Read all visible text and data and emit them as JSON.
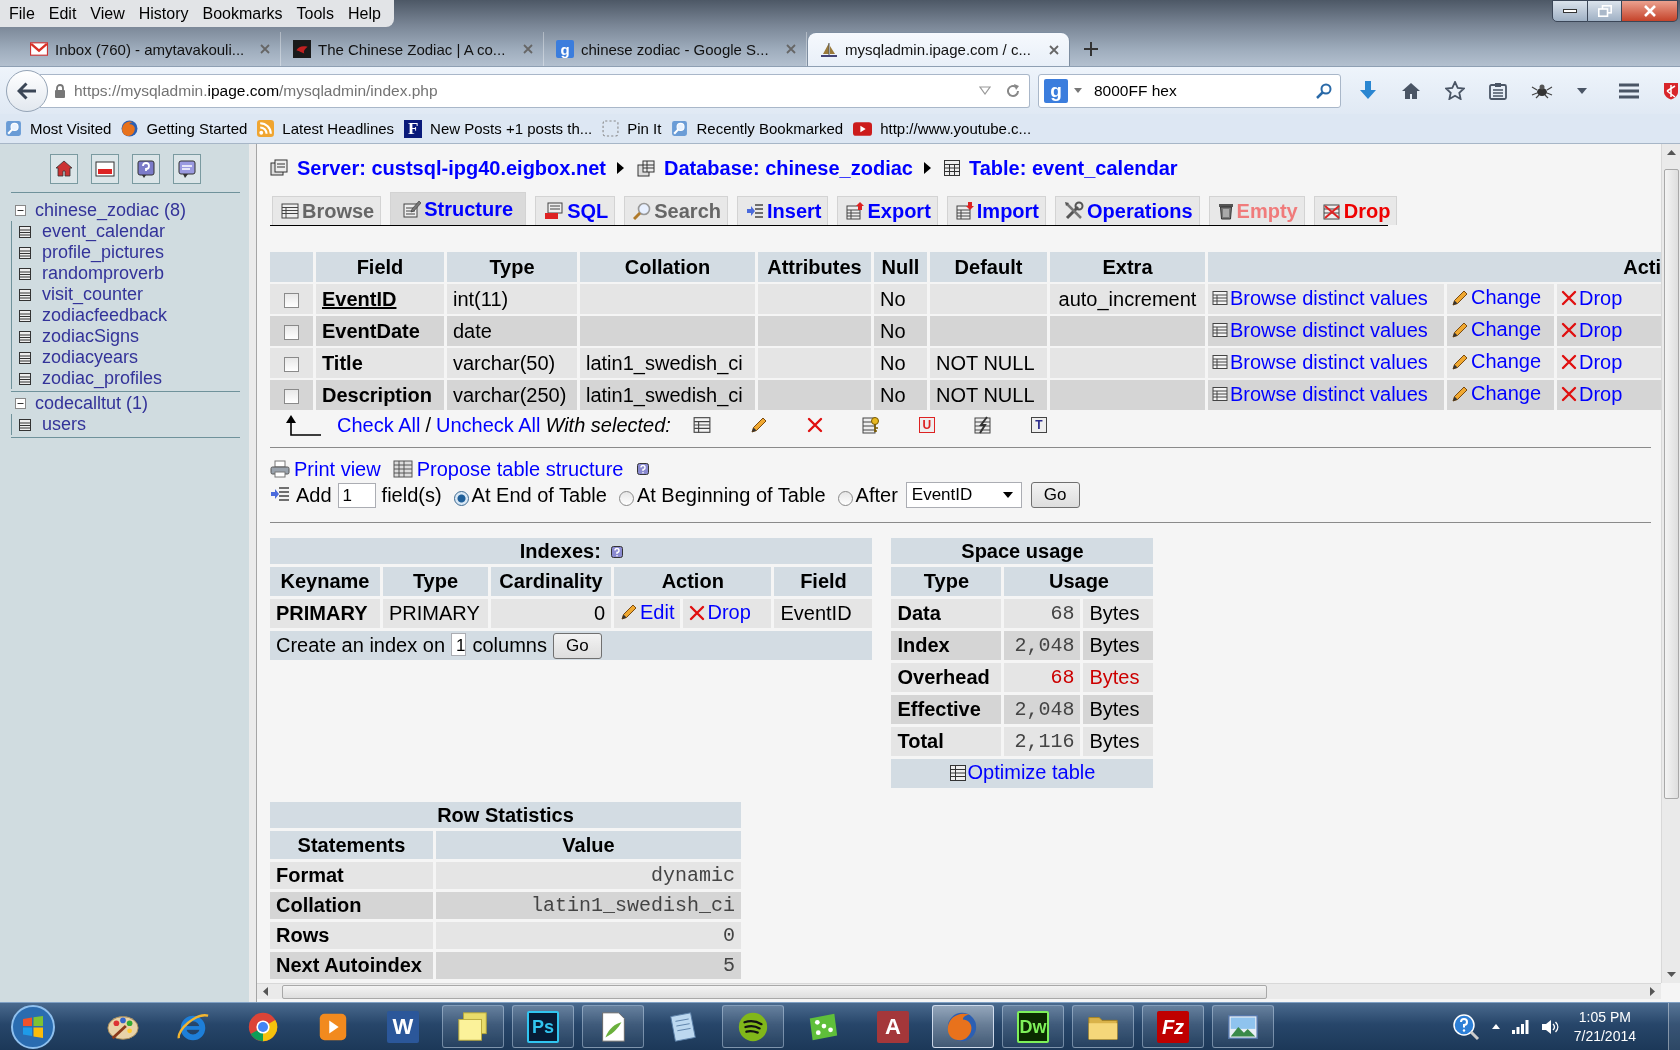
{
  "menu_bar": [
    "File",
    "Edit",
    "View",
    "History",
    "Bookmarks",
    "Tools",
    "Help"
  ],
  "browser_tabs": [
    {
      "kind": "mail",
      "title": "Inbox (760) - amytavakouli...",
      "selected": false
    },
    {
      "kind": "photo",
      "title": "The Chinese Zodiac | A co...",
      "selected": false
    },
    {
      "kind": "search",
      "glyph": "g",
      "title": "chinese zodiac - Google S...",
      "selected": false
    },
    {
      "kind": "pma",
      "title": "mysqladmin.ipage.com / c...",
      "selected": true
    }
  ],
  "address_bar": {
    "prefix": "https://mysqladmin.",
    "domain": "ipage.com",
    "path": "/mysqladmin/index.php"
  },
  "search_bar": {
    "glyph": "g",
    "value": "8000FF hex"
  },
  "bookmarks": [
    {
      "kind": "folder",
      "label": "Most Visited"
    },
    {
      "kind": "firefox",
      "label": "Getting Started"
    },
    {
      "kind": "feed",
      "label": "Latest Headlines"
    },
    {
      "kind": "letter",
      "glyph": "F",
      "label": "New Posts +1 posts th..."
    },
    {
      "kind": "dashed",
      "label": "Pin It"
    },
    {
      "kind": "folder",
      "label": "Recently Bookmarked"
    },
    {
      "kind": "video",
      "label": "http://www.youtube.c..."
    }
  ],
  "sidebar": {
    "databases": [
      {
        "name": "chinese_zodiac (8)",
        "expanded": true,
        "children": [
          {
            "name": "event_calendar"
          },
          {
            "name": "profile_pictures"
          },
          {
            "name": "randomproverb"
          },
          {
            "name": "visit_counter"
          },
          {
            "name": "zodiacfeedback"
          },
          {
            "name": "zodiacSigns"
          },
          {
            "name": "zodiacyears"
          },
          {
            "name": "zodiac_profiles"
          }
        ]
      },
      {
        "name": "codecalltut (1)",
        "expanded": true,
        "children": [
          {
            "name": "users"
          }
        ]
      }
    ]
  },
  "breadcrumb": [
    {
      "kind": "server",
      "label": "Server: custsql-ipg40.eigbox.net"
    },
    {
      "kind": "database",
      "label": "Database: chinese_zodiac"
    },
    {
      "kind": "table",
      "label": "Table: event_calendar"
    }
  ],
  "tabs": [
    {
      "kind": "browse",
      "label": "Browse",
      "selected": false,
      "disabled": true,
      "caution": false
    },
    {
      "kind": "structure",
      "label": "Structure",
      "selected": true,
      "disabled": false,
      "caution": false
    },
    {
      "kind": "sql",
      "label": "SQL",
      "selected": false,
      "disabled": false,
      "caution": false
    },
    {
      "kind": "search",
      "label": "Search",
      "selected": false,
      "disabled": true,
      "caution": false
    },
    {
      "kind": "insert",
      "label": "Insert",
      "selected": false,
      "disabled": false,
      "caution": false
    },
    {
      "kind": "export",
      "label": "Export",
      "selected": false,
      "disabled": false,
      "caution": false
    },
    {
      "kind": "import",
      "label": "Import",
      "selected": false,
      "disabled": false,
      "caution": false
    },
    {
      "kind": "operations",
      "label": "Operations",
      "selected": false,
      "disabled": false,
      "caution": false
    },
    {
      "kind": "empty",
      "label": "Empty",
      "selected": false,
      "disabled": true,
      "caution": true
    },
    {
      "kind": "drop",
      "label": "Drop",
      "selected": false,
      "disabled": false,
      "caution": true
    }
  ],
  "structure": {
    "columns": [
      "Field",
      "Type",
      "Collation",
      "Attributes",
      "Null",
      "Default",
      "Extra",
      "Acti"
    ],
    "rows": [
      {
        "checked": false,
        "primary": true,
        "field": "EventID",
        "type": "int(11)",
        "null": "No",
        "extra": "auto_increment",
        "actions": [
          {
            "kind": "browse",
            "label": "Browse distinct values"
          },
          {
            "kind": "change",
            "label": "Change"
          },
          {
            "kind": "drop",
            "label": "Drop"
          }
        ]
      },
      {
        "checked": false,
        "primary": false,
        "field": "EventDate",
        "type": "date",
        "null": "No",
        "actions": [
          {
            "kind": "browse",
            "label": "Browse distinct values"
          },
          {
            "kind": "change",
            "label": "Change"
          },
          {
            "kind": "drop",
            "label": "Drop"
          }
        ]
      },
      {
        "checked": false,
        "primary": false,
        "field": "Title",
        "type": "varchar(50)",
        "collation": "latin1_swedish_ci",
        "null": "No",
        "default": "NOT NULL",
        "actions": [
          {
            "kind": "browse",
            "label": "Browse distinct values"
          },
          {
            "kind": "change",
            "label": "Change"
          },
          {
            "kind": "drop",
            "label": "Drop"
          }
        ]
      },
      {
        "checked": false,
        "primary": false,
        "field": "Description",
        "type": "varchar(250)",
        "collation": "latin1_swedish_ci",
        "null": "No",
        "default": "NOT NULL",
        "actions": [
          {
            "kind": "browse",
            "label": "Browse distinct values"
          },
          {
            "kind": "change",
            "label": "Change"
          },
          {
            "kind": "drop",
            "label": "Drop"
          }
        ]
      }
    ],
    "check_all": "Check All",
    "separator": "/",
    "uncheck_all": "Uncheck All",
    "with_selected": "With selected:",
    "bulk_actions": [
      {
        "kind": "browse"
      },
      {
        "kind": "change"
      },
      {
        "kind": "drop"
      },
      {
        "kind": "primary"
      },
      {
        "kind": "unique",
        "glyph": "U"
      },
      {
        "kind": "index"
      },
      {
        "kind": "fulltext",
        "glyph": "T"
      }
    ]
  },
  "links": [
    {
      "kind": "print",
      "label": "Print view"
    },
    {
      "kind": "propose",
      "label": "Propose table structure"
    }
  ],
  "add_field": {
    "label": "Add",
    "value": "1",
    "unit": "field(s)",
    "positions": [
      {
        "label": "At End of Table",
        "selected": true
      },
      {
        "label": "At Beginning of Table",
        "selected": false
      },
      {
        "label": "After",
        "selected": false
      }
    ],
    "after_field": "EventID",
    "button": "Go"
  },
  "indexes": {
    "title": "Indexes:",
    "columns": [
      "Keyname",
      "Type",
      "Cardinality",
      "Action",
      "Field"
    ],
    "rows": [
      {
        "keyname": "PRIMARY",
        "type": "PRIMARY",
        "cardinality": "0",
        "actions": [
          {
            "kind": "edit",
            "label": "Edit"
          },
          {
            "kind": "drop",
            "label": "Drop"
          }
        ],
        "field": "EventID"
      }
    ],
    "create": {
      "label": "Create an index on",
      "value": "1",
      "unit": "columns",
      "button": "Go"
    }
  },
  "space_usage": {
    "title": "Space usage",
    "columns": [
      "Type",
      "Usage"
    ],
    "rows": [
      {
        "type": "Data",
        "value": "68",
        "unit": "Bytes",
        "warning": false
      },
      {
        "type": "Index",
        "value": "2,048",
        "unit": "Bytes",
        "warning": false
      },
      {
        "type": "Overhead",
        "value": "68",
        "unit": "Bytes",
        "warning": true
      },
      {
        "type": "Effective",
        "value": "2,048",
        "unit": "Bytes",
        "warning": false
      },
      {
        "type": "Total",
        "value": "2,116",
        "unit": "Bytes",
        "warning": false
      }
    ],
    "optimize": "Optimize table"
  },
  "row_statistics": {
    "title": "Row Statistics",
    "columns": [
      "Statements",
      "Value"
    ],
    "rows": [
      {
        "label": "Format",
        "value": "dynamic"
      },
      {
        "label": "Collation",
        "value": "latin1_swedish_ci"
      },
      {
        "label": "Rows",
        "value": "0"
      },
      {
        "label": "Next Autoindex",
        "value": "5"
      }
    ]
  },
  "taskbar": {
    "apps": [
      {
        "kind": "paint",
        "running": false,
        "selected": false
      },
      {
        "kind": "ie",
        "running": false,
        "selected": false
      },
      {
        "kind": "chrome",
        "running": false,
        "selected": false
      },
      {
        "kind": "media",
        "running": false,
        "selected": false
      },
      {
        "kind": "word",
        "glyph": "W",
        "running": false,
        "selected": false
      },
      {
        "kind": "sticky",
        "running": true,
        "selected": false
      },
      {
        "kind": "photoshop",
        "glyph": "Ps",
        "running": true,
        "selected": false
      },
      {
        "kind": "notepadpp",
        "running": true,
        "selected": false
      },
      {
        "kind": "notepad",
        "running": false,
        "selected": false
      },
      {
        "kind": "spotify",
        "running": true,
        "selected": false
      },
      {
        "kind": "game",
        "running": false,
        "selected": false
      },
      {
        "kind": "access",
        "glyph": "A",
        "running": false,
        "selected": false
      },
      {
        "kind": "firefox",
        "running": true,
        "selected": true
      },
      {
        "kind": "dreamweaver",
        "glyph": "Dw",
        "running": true,
        "selected": false
      },
      {
        "kind": "explorer",
        "running": true,
        "selected": false
      },
      {
        "kind": "filezilla",
        "glyph": "Fz",
        "running": true,
        "selected": false
      },
      {
        "kind": "photos",
        "running": true,
        "selected": false
      }
    ],
    "clock": {
      "time": "1:05 PM",
      "date": "7/21/2014"
    }
  }
}
